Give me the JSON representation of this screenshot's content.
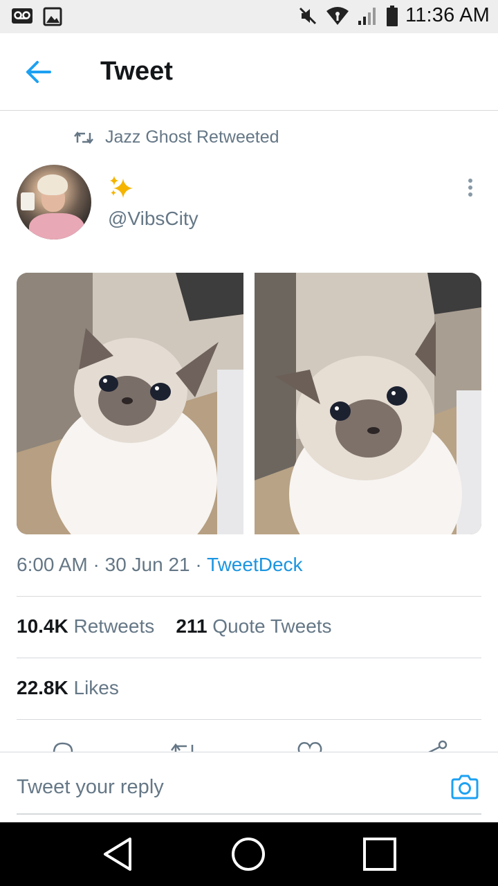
{
  "status_bar": {
    "time": "11:36 AM",
    "icons": [
      "voicemail-icon",
      "image-icon",
      "mute-icon",
      "wifi-icon",
      "signal-icon",
      "battery-icon"
    ]
  },
  "header": {
    "title": "Tweet",
    "back_icon": "arrow-left-icon"
  },
  "tweet": {
    "retweeted_by": "Jazz Ghost Retweeted",
    "author_display_name": "✨",
    "author_handle": "@VibsCity",
    "images": [
      "cat-photo-1",
      "cat-photo-2"
    ],
    "time": "6:00 AM",
    "separator": " · ",
    "date": "30 Jun 21",
    "source": "TweetDeck"
  },
  "stats": {
    "retweets_count": "10.4K",
    "retweets_label": "Retweets",
    "quotes_count": "211",
    "quotes_label": "Quote Tweets",
    "likes_count": "22.8K",
    "likes_label": "Likes"
  },
  "reply": {
    "placeholder": "Tweet your reply"
  },
  "colors": {
    "accent": "#1da1f2",
    "link": "#1b95e0",
    "secondary_text": "#657786",
    "primary_text": "#14171a",
    "divider": "#d6d9db",
    "status_bar_bg": "#eeeeee",
    "nav_bar_bg": "#000000"
  }
}
